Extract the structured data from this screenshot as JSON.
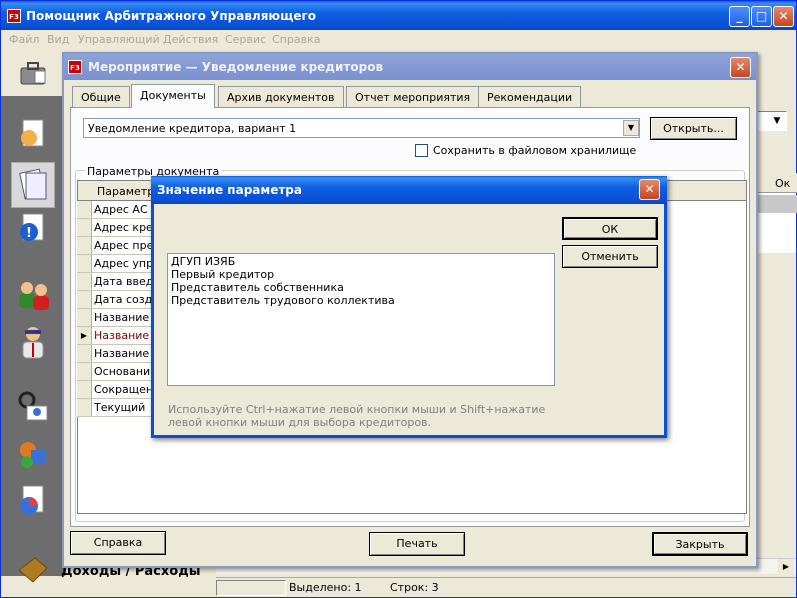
{
  "main_window": {
    "title": "Помощник Арбитражного Управляющего",
    "menu": [
      "Файл",
      "Вид",
      "Управляющий",
      "Действия",
      "Сервис",
      "Справка"
    ],
    "bottom_label": "Доходы / Расходы",
    "status": {
      "selected": "Выделено: 1",
      "rows": "Строк: 3"
    },
    "right_grid_header": "Ок"
  },
  "event_dialog": {
    "title": "Мероприятие — Уведомление кредиторов",
    "tabs": [
      "Общие",
      "Документы",
      "Архив документов",
      "Отчет мероприятия",
      "Рекомендации"
    ],
    "active_tab": 1,
    "document_select": "Уведомление кредитора, вариант 1",
    "open_button": "Открыть...",
    "save_checkbox": {
      "label": "Сохранить в файловом хранилище",
      "checked": false
    },
    "params_group_label": "Параметры документа",
    "params_header": "Параметр",
    "params_rows": [
      "Адрес АС",
      "Адрес кре",
      "Адрес пре",
      "Адрес упр",
      "Дата введ",
      "Дата созд",
      "Название",
      "Название",
      "Название",
      "Основани",
      "Сокращен",
      "Текущий"
    ],
    "current_row": 7,
    "buttons": {
      "help": "Справка",
      "print": "Печать",
      "close": "Закрыть"
    }
  },
  "param_dialog": {
    "title": "Значение параметра",
    "ok": "ОК",
    "cancel": "Отменить",
    "list_items": [
      "ДГУП ИЗЯБ",
      "Первый кредитор",
      "Представитель собственника",
      "Представитель трудового коллектива"
    ],
    "hint": "Используйте Ctrl+нажатие левой кнопки мыши и Shift+нажатие левой кнопки мыши для выбора кредиторов."
  }
}
